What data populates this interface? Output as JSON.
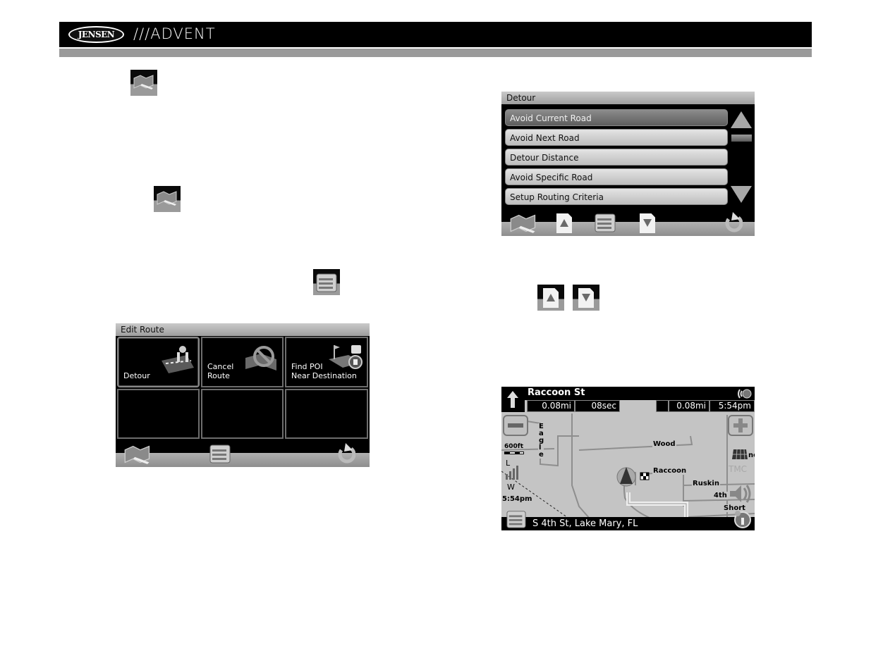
{
  "header": {
    "brand_left": "JENSEN",
    "brand_right": "///ADVENT"
  },
  "icons": {
    "map_icon": "map-icon",
    "list_icon": "options-list-icon",
    "page_up_icon": "page-up-icon",
    "page_down_icon": "page-down-icon"
  },
  "edit_route": {
    "title": "Edit Route",
    "tiles": [
      {
        "label": "Detour",
        "icon": "detour-icon",
        "selected": true
      },
      {
        "label": "Cancel\nRoute",
        "icon": "cancel-route-icon",
        "selected": false
      },
      {
        "label": "Find POI\nNear Destination",
        "icon": "poi-icon",
        "selected": false
      },
      {
        "label": "",
        "selected": false
      },
      {
        "label": "",
        "selected": false
      },
      {
        "label": "",
        "selected": false
      }
    ],
    "bottom_bar": [
      "map-icon",
      "options-list-icon",
      "back-icon"
    ]
  },
  "detour": {
    "title": "Detour",
    "items": [
      {
        "label": "Avoid Current Road",
        "active": true
      },
      {
        "label": "Avoid Next Road",
        "active": false
      },
      {
        "label": "Detour Distance",
        "active": false
      },
      {
        "label": "Avoid Specific Road",
        "active": false
      },
      {
        "label": "Setup Routing Criteria",
        "active": false
      }
    ],
    "bottom_bar": [
      "map-icon",
      "page-up-icon",
      "options-list-icon",
      "page-down-icon",
      "back-icon"
    ]
  },
  "map": {
    "street": "Raccoon St",
    "distance_to_turn": "0.08mi",
    "time_to_turn": "08sec",
    "distance_to_dest": "0.08mi",
    "eta": "5:54pm",
    "scale": "600ft",
    "clock": "5:54pm",
    "tmc_label": "TMC",
    "address": "S 4th St, Lake Mary, FL",
    "roads": {
      "eagle": "Eagle",
      "wood": "Wood",
      "raccoon": "Raccoon",
      "ruskin": "Ruskin",
      "fourth": "4th",
      "short": "Short",
      "partial": "ne"
    },
    "gps_side_letters": [
      "L",
      "W"
    ]
  }
}
